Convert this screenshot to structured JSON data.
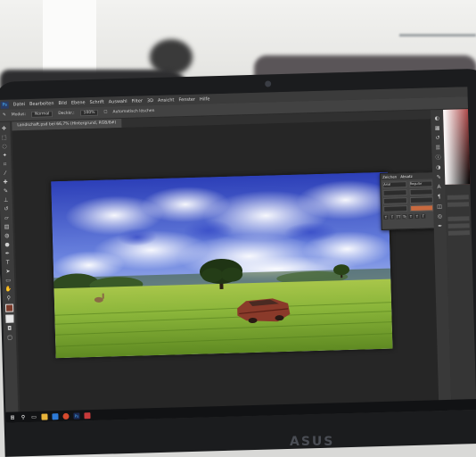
{
  "photoshop": {
    "app_badge": "Ps",
    "menu": [
      "Datei",
      "Bearbeiten",
      "Bild",
      "Ebene",
      "Schrift",
      "Auswahl",
      "Filter",
      "3D",
      "Ansicht",
      "Fenster",
      "Hilfe"
    ],
    "options": {
      "mode_label": "Modus:",
      "mode_value": "Normal",
      "opacity_label": "Deckkr.:",
      "opacity_value": "100%",
      "auto_label": "Automatisch löschen"
    },
    "document_tab": "Landschaft.psd bei 66,7% (Hintergrund, RGB/8#)",
    "character_panel": {
      "tabs": [
        "Zeichen",
        "Absatz"
      ],
      "font_family": "Arial",
      "font_style": "Regular"
    }
  },
  "brand": {
    "laptop_logo": "ASUS"
  },
  "colors": {
    "ps_accent": "#48b6ff",
    "highlight_field": "#c86a3f"
  },
  "icons": {
    "taskbar": [
      "windows-start-icon",
      "search-icon",
      "task-view-icon",
      "file-explorer-icon",
      "store-icon",
      "chrome-icon",
      "photoshop-icon",
      "app-icon"
    ]
  }
}
